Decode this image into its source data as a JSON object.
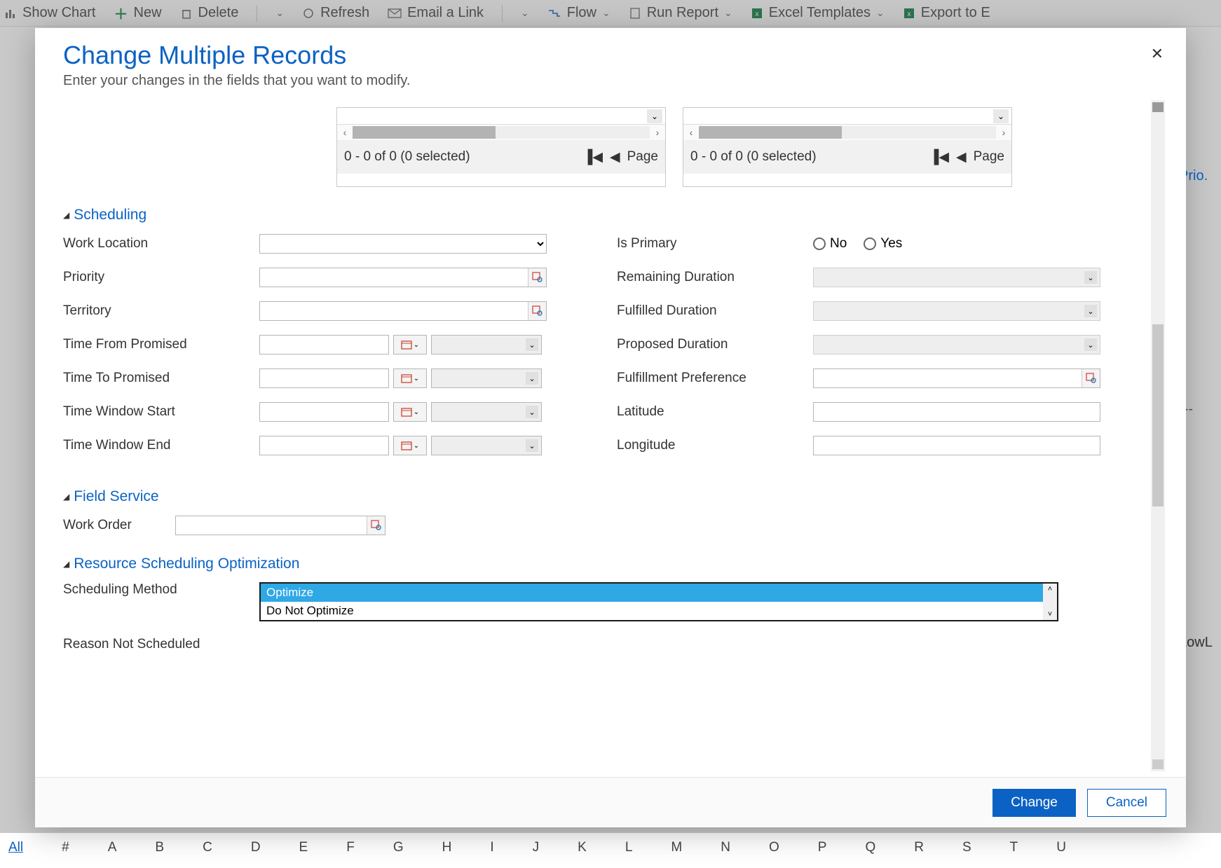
{
  "toolbar": {
    "show_chart": "Show Chart",
    "new": "New",
    "delete": "Delete",
    "refresh": "Refresh",
    "email_link": "Email a Link",
    "flow": "Flow",
    "run_report": "Run Report",
    "excel_templates": "Excel Templates",
    "export": "Export to E"
  },
  "bg": {
    "prio": "Prio.",
    "lowl": "LowL",
    "dash": "---"
  },
  "modal": {
    "title": "Change Multiple Records",
    "subtitle": "Enter your changes in the fields that you want to modify.",
    "close": "✕"
  },
  "grid": {
    "status": "0 - 0 of 0 (0 selected)",
    "page": "Page"
  },
  "sections": {
    "scheduling": "Scheduling",
    "field_service": "Field Service",
    "rso": "Resource Scheduling Optimization"
  },
  "labels": {
    "work_location": "Work Location",
    "priority": "Priority",
    "territory": "Territory",
    "time_from_promised": "Time From Promised",
    "time_to_promised": "Time To Promised",
    "time_window_start": "Time Window Start",
    "time_window_end": "Time Window End",
    "is_primary": "Is Primary",
    "remaining_duration": "Remaining Duration",
    "fulfilled_duration": "Fulfilled Duration",
    "proposed_duration": "Proposed Duration",
    "fulfillment_preference": "Fulfillment Preference",
    "latitude": "Latitude",
    "longitude": "Longitude",
    "work_order": "Work Order",
    "scheduling_method": "Scheduling Method",
    "reason_not_scheduled": "Reason Not Scheduled",
    "no": "No",
    "yes": "Yes"
  },
  "options": {
    "optimize": "Optimize",
    "do_not_optimize": "Do Not Optimize"
  },
  "footer": {
    "change": "Change",
    "cancel": "Cancel"
  },
  "alpha": {
    "all": "All",
    "hash": "#",
    "A": "A",
    "B": "B",
    "C": "C",
    "D": "D",
    "E": "E",
    "F": "F",
    "G": "G",
    "H": "H",
    "I": "I",
    "J": "J",
    "K": "K",
    "L": "L",
    "M": "M",
    "N": "N",
    "O": "O",
    "P": "P",
    "Q": "Q",
    "R": "R",
    "S": "S",
    "T": "T",
    "U": "U"
  }
}
